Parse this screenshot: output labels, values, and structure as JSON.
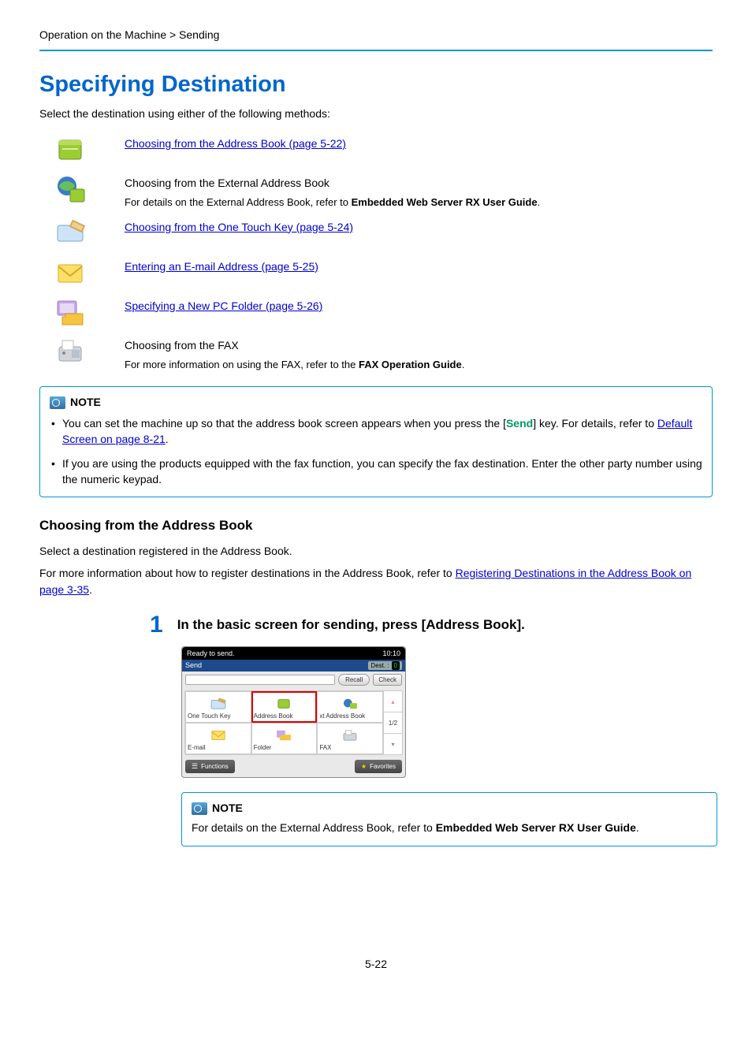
{
  "breadcrumb": "Operation on the Machine > Sending",
  "title": "Specifying Destination",
  "intro": "Select the destination using either of the following methods:",
  "methods": {
    "addressBook": {
      "link": "Choosing from the Address Book (page 5-22)"
    },
    "external": {
      "heading": "Choosing from the External Address Book",
      "detail_prefix": "For details on the External Address Book, refer to ",
      "detail_bold": "Embedded Web Server RX User Guide",
      "detail_suffix": "."
    },
    "oneTouch": {
      "link": "Choosing from the One Touch Key (page 5-24)"
    },
    "email": {
      "link": "Entering an E-mail Address (page 5-25)"
    },
    "pcFolder": {
      "link": "Specifying a New PC Folder (page 5-26)"
    },
    "fax": {
      "heading": "Choosing from the FAX",
      "detail_prefix": "For more information on using the FAX, refer to the ",
      "detail_bold": "FAX Operation Guide",
      "detail_suffix": "."
    }
  },
  "note1": {
    "label": "NOTE",
    "items": [
      {
        "pre": "You can set the machine up so that the address book screen appears when you press the [",
        "key": "Send",
        "mid": "] key. For details, refer to ",
        "link": "Default Screen on page 8-21",
        "post": "."
      },
      {
        "text": "If you are using the products equipped with the fax function, you can specify the fax destination. Enter the other party number using the numeric keypad."
      }
    ]
  },
  "section": {
    "heading": "Choosing from the Address Book",
    "p1": "Select a destination registered in the Address Book.",
    "p2_pre": "For more information about how to register destinations in the Address Book, refer to ",
    "p2_link": "Registering Destinations in the Address Book on page 3-35",
    "p2_post": "."
  },
  "step1": {
    "num": "1",
    "text": "In the basic screen for sending, press [Address Book]."
  },
  "panel": {
    "status": "Ready to send.",
    "time": "10:10",
    "mode": "Send",
    "destLabel": "Dest. :",
    "destCount": "0",
    "recall": "Recall",
    "check": "Check",
    "cells": {
      "oneTouch": "One Touch Key",
      "addrBook": "Address Book",
      "extAddr": "xt Address Book",
      "email": "E-mail",
      "folder": "Folder",
      "fax": "FAX"
    },
    "pageIndicator": "1/2",
    "functions": "Functions",
    "favorites": "Favorites"
  },
  "note2": {
    "label": "NOTE",
    "text_prefix": "For details on the External Address Book, refer to ",
    "text_bold": "Embedded Web Server RX User Guide",
    "text_suffix": "."
  },
  "pageNumber": "5-22"
}
